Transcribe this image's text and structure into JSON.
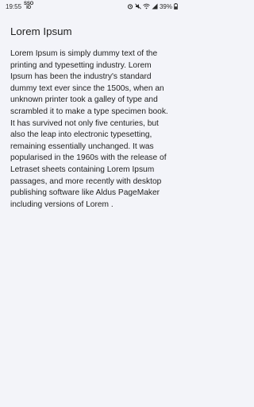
{
  "status_bar": {
    "time": "19:55",
    "small_label_top": "SSO",
    "small_label_bottom": "IO",
    "battery_percent": "39%"
  },
  "page": {
    "title": "Lorem Ipsum",
    "body": "Lorem Ipsum is simply dummy text of the printing and typesetting industry. Lorem Ipsum has been the industry's standard dummy text ever since the 1500s, when an unknown printer took a galley of type and scrambled it to make a type specimen book. It has survived not only five centuries, but also the leap into electronic typesetting, remaining essentially unchanged. It was popularised in the 1960s with the release of Letraset sheets containing Lorem Ipsum passages, and more recently with desktop publishing software like Aldus PageMaker including versions of Lorem ."
  },
  "icons": {
    "status_left": [
      "notification-icon"
    ],
    "status_right": [
      "alarm-icon",
      "mute-icon",
      "wifi-icon",
      "signal-icon",
      "battery-icon"
    ]
  }
}
